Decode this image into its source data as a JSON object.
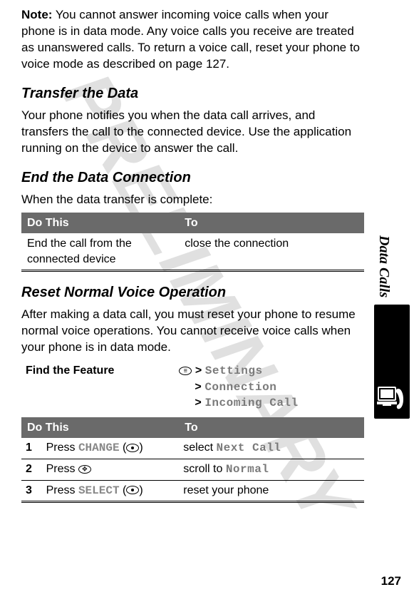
{
  "watermark": "PRELIMINARY",
  "note_label": "Note:",
  "note_body": " You cannot answer incoming voice calls when your phone is in data mode. Any voice calls you receive are treated as unanswered calls. To return a voice call, reset your phone to voice mode as described on page 127.",
  "sections": {
    "transfer": {
      "heading": "Transfer the Data",
      "body": "Your phone notifies you when the data call arrives, and transfers the call to the connected device. Use the application running on the device to answer the call."
    },
    "end": {
      "heading": "End the Data Connection",
      "body": "When the data transfer is complete:",
      "table": {
        "head": {
          "c1": "Do This",
          "c2": "To"
        },
        "row": {
          "c1": "End the call from the connected device",
          "c2": "close the connection"
        }
      }
    },
    "reset": {
      "heading": "Reset Normal Voice Operation",
      "body": "After making a data call, you must reset your phone to resume normal voice operations. You cannot receive voice calls when your phone is in data mode.",
      "find_label": "Find the Feature",
      "path": {
        "l1a": ">",
        "l1b": "Settings",
        "l2a": ">",
        "l2b": "Connection",
        "l3a": ">",
        "l3b": "Incoming Call"
      },
      "steps": {
        "head": {
          "c1": "Do This",
          "c2": "To"
        },
        "rows": [
          {
            "n": "1",
            "action_pre": "Press ",
            "action_lcd": "CHANGE",
            "action_post": " (",
            "action_close": ")",
            "to_pre": "select ",
            "to_lcd": "Next Call"
          },
          {
            "n": "2",
            "action_pre": "Press ",
            "action_lcd": "",
            "action_post": "",
            "action_close": "",
            "to_pre": "scroll to ",
            "to_lcd": "Normal"
          },
          {
            "n": "3",
            "action_pre": "Press ",
            "action_lcd": "SELECT",
            "action_post": " (",
            "action_close": ")",
            "to_pre": "reset your phone",
            "to_lcd": ""
          }
        ]
      }
    }
  },
  "side_label": "Data Calls",
  "page_number": "127"
}
